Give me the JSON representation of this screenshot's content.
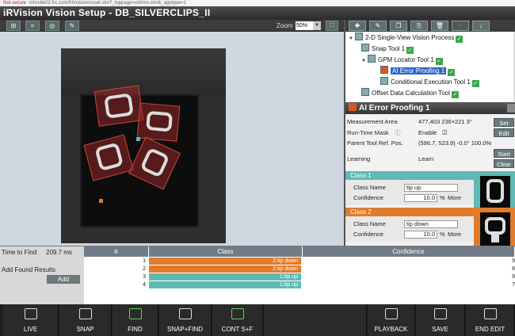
{
  "browser": {
    "security": "Not secure",
    "url": "mhrobb02.frc.com/frh/vision/vsset.stm?_toppage=vsfrmn.stm&_apptype=1"
  },
  "app": {
    "title": "iRVision Vision Setup - DB_SILVERCLIPS_II"
  },
  "toolbar": {
    "zoom_label": "Zoom",
    "zoom_value": "50%"
  },
  "tree": {
    "nodes": [
      {
        "label": "2-D Single-View Vision Process",
        "status": "ok"
      },
      {
        "label": "Snap Tool 1",
        "status": "ok"
      },
      {
        "label": "GPM Locator Tool 1",
        "status": "ok"
      },
      {
        "label": "AI Error Proofing 1",
        "status": "ok",
        "selected": true
      },
      {
        "label": "Conditional Execution Tool 1",
        "status": "ok"
      },
      {
        "label": "Offset Data Calculation Tool",
        "status": "ok"
      }
    ]
  },
  "panel": {
    "title": "AI Error Proofing 1",
    "measurement_area_label": "Measurement Area",
    "measurement_area_value": "477,403 236×221 3°",
    "set_label": "Set",
    "runtime_mask_label": "Run-Time Mask",
    "enable_label": "Enable",
    "edit_label": "Edit",
    "parent_ref_label": "Parent Tool Ref. Pos.",
    "parent_ref_value": "(596.7, 523.9) -0.0° 100.0%",
    "learning_label": "Learning",
    "learn_label": "Learn",
    "start_label": "Start",
    "clear_label": "Clear",
    "classes": [
      {
        "header": "Class 1",
        "name_label": "Class Name",
        "name": "tip up",
        "conf_label": "Confidence",
        "conf": "10.0",
        "unit": "%",
        "more": "More",
        "color": "#5fb9b4"
      },
      {
        "header": "Class 2",
        "name_label": "Class Name",
        "name": "tip down",
        "conf_label": "Confidence",
        "conf": "10.0",
        "unit": "%",
        "more": "More",
        "color": "#e07b2c"
      }
    ]
  },
  "results": {
    "time_label": "Time to Find",
    "time_value": "209.7 ms",
    "add_found_label": "Add Found Results",
    "add_label": "Add",
    "columns": [
      "#",
      "Class",
      "Confidence"
    ],
    "rows": [
      {
        "n": "1",
        "cls": "2:tip down",
        "conf": "9",
        "color": "#e07b2c"
      },
      {
        "n": "2",
        "cls": "2:tip down",
        "conf": "8",
        "color": "#e07b2c"
      },
      {
        "n": "3",
        "cls": "1:tip up",
        "conf": "9",
        "color": "#5fb9b4"
      },
      {
        "n": "4",
        "cls": "1:tip up",
        "conf": "7",
        "color": "#5fb9b4"
      }
    ]
  },
  "buttons": {
    "live": "LIVE",
    "snap": "SNAP",
    "find": "FIND",
    "snap_find": "SNAP+FIND",
    "cont": "CONT S+F",
    "playback": "PLAYBACK",
    "save": "SAVE",
    "end_edit": "END EDIT"
  }
}
